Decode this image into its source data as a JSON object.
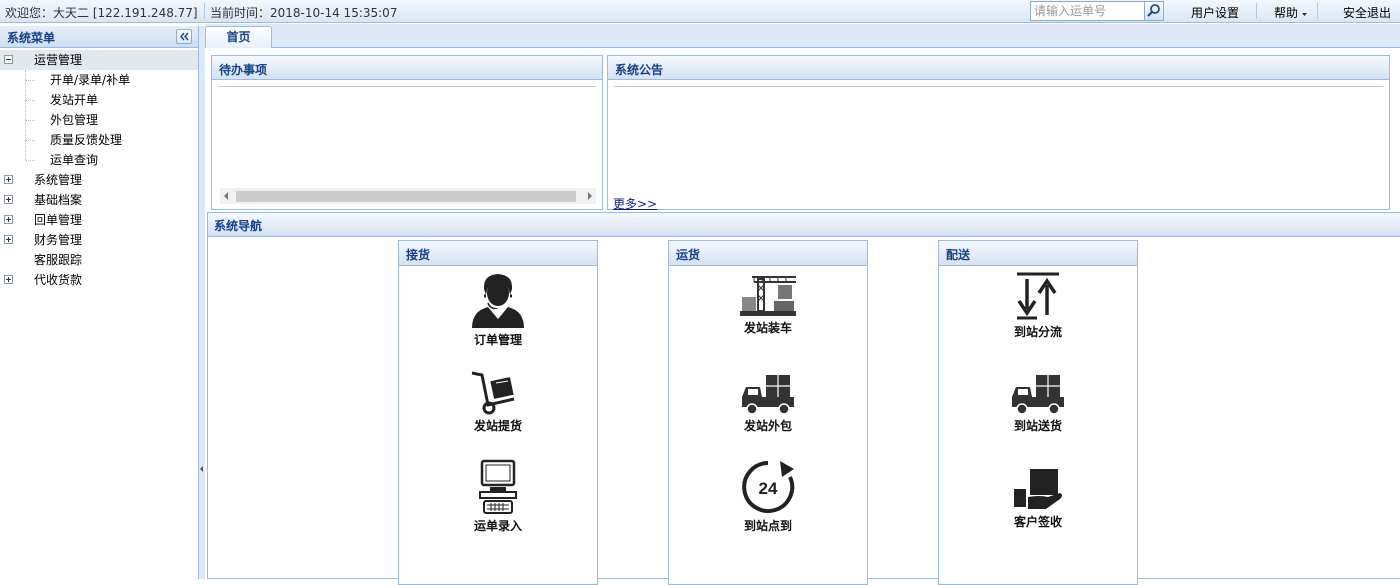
{
  "topbar": {
    "welcome": "欢迎您：大天二  [122.191.248.77]",
    "time": "当前时间：2018-10-14 15:35:07",
    "search_placeholder": "请输入运单号",
    "user_settings": "用户设置",
    "help": "帮助",
    "logout": "安全退出"
  },
  "menu": {
    "title": "系统菜单",
    "items": [
      {
        "label": "运营管理",
        "expanded": true,
        "selected": true,
        "children": [
          "开单/录单/补单",
          "发站开单",
          "外包管理",
          "质量反馈处理",
          "运单查询"
        ]
      },
      {
        "label": "系统管理",
        "expanded": false
      },
      {
        "label": "基础档案",
        "expanded": false
      },
      {
        "label": "回单管理",
        "expanded": false
      },
      {
        "label": "财务管理",
        "expanded": false
      },
      {
        "label": "客服跟踪",
        "expanded": false
      },
      {
        "label": "代收货款",
        "expanded": false
      }
    ]
  },
  "tabs": [
    {
      "label": "首页",
      "active": true
    }
  ],
  "todo": {
    "title": "待办事项"
  },
  "notice": {
    "title": "系统公告",
    "more": "更多>>"
  },
  "navigation": {
    "title": "系统导航",
    "groups": [
      {
        "title": "接货",
        "items": [
          {
            "label": "订单管理",
            "icon": "customer-service-icon"
          },
          {
            "label": "发站提货",
            "icon": "hand-truck-icon"
          },
          {
            "label": "运单录入",
            "icon": "computer-icon"
          }
        ]
      },
      {
        "title": "运货",
        "items": [
          {
            "label": "发站装车",
            "icon": "crane-loading-icon"
          },
          {
            "label": "发站外包",
            "icon": "delivery-truck-icon"
          },
          {
            "label": "到站点到",
            "icon": "clock-24-icon"
          }
        ]
      },
      {
        "title": "配送",
        "items": [
          {
            "label": "到站分流",
            "icon": "sort-arrows-icon"
          },
          {
            "label": "到站送货",
            "icon": "delivery-truck-icon"
          },
          {
            "label": "客户签收",
            "icon": "hand-package-icon"
          }
        ]
      }
    ]
  },
  "colors": {
    "header_text": "#15428b",
    "border": "#99bbe8",
    "panel_bg": "#dfe8f6"
  }
}
